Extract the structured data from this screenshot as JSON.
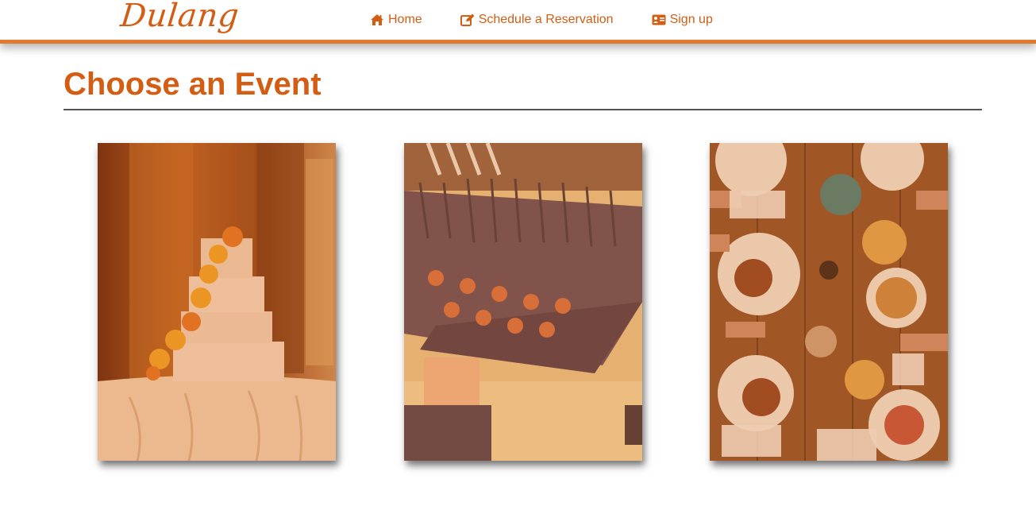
{
  "brand": {
    "logo_text": "Dulang",
    "accent_color": "#e07a2e",
    "text_color": "#d45d14"
  },
  "nav": {
    "items": [
      {
        "label": "Home",
        "icon": "home-icon"
      },
      {
        "label": "Schedule a Reservation",
        "icon": "edit-icon"
      },
      {
        "label": "Sign up",
        "icon": "id-card-icon"
      }
    ]
  },
  "main": {
    "title": "Choose an Event",
    "events": [
      {
        "image": "wedding-cake-photo"
      },
      {
        "image": "catering-appetizers-photo"
      },
      {
        "image": "brunch-table-photo"
      }
    ]
  }
}
